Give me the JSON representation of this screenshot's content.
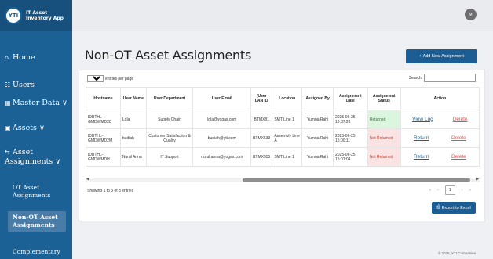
{
  "app": {
    "logo_text": "YTI",
    "name_line1": "IT Asset",
    "name_line2": "Inventory App"
  },
  "user": {
    "initials": "M"
  },
  "sidebar": {
    "items": [
      {
        "icon": "home-icon",
        "glyph": "⌂",
        "label": "Home"
      },
      {
        "icon": "users-icon",
        "glyph": "☷",
        "label": "Users"
      },
      {
        "icon": "database-icon",
        "glyph": "▦",
        "label": "Master Data ∨"
      },
      {
        "icon": "assets-icon",
        "glyph": "▣",
        "label": "Assets ∨"
      },
      {
        "icon": "swap-icon",
        "glyph": "⇆",
        "label": "Asset",
        "label2": "Assignments ∨"
      }
    ],
    "sub_items": [
      {
        "label": "OT Asset",
        "label2": "Assignments"
      },
      {
        "label": "Non-OT Asset",
        "label2": "Assignments"
      },
      {
        "label": "Complementary"
      }
    ]
  },
  "page": {
    "title": "Non-OT Asset Assignments",
    "add_button": "+ Add New Assignment",
    "entries_value": "10",
    "entries_label": "entries per page",
    "search_label": "Search:",
    "search_value": "",
    "showing": "Showing 1 to 3 of 3 entries",
    "pager": {
      "first": "«",
      "prev": "‹",
      "current": "1",
      "next": "›",
      "last": "»"
    },
    "export_button": "Export to Excel",
    "footer": "© 2025, YTI Companies"
  },
  "table": {
    "headers": [
      "Hostname",
      "User Name",
      "User Department",
      "User Email",
      "(User LAN ID",
      "Location",
      "Assigned By",
      "Assignment Date",
      "Assignment Status",
      "Action"
    ],
    "rows": [
      {
        "hostname": "IDBTHL-GMDWMD28",
        "user_name": "Lola",
        "department": "Supply Chain",
        "email": "lola@yogas.com",
        "lan_id": "BTMX81",
        "location": "SMT Line 1",
        "assigned_by": "Yumna Rahi",
        "date": "2025-06-25 13:37:28",
        "status": "Returned",
        "status_type": "returned",
        "action1": "View Log",
        "action2": "Delete"
      },
      {
        "hostname": "IDBTHL-GMDWMD2M",
        "user_name": "budiah",
        "department": "Customer Satisfaction & Quality",
        "email": "budiah@yti.com",
        "lan_id": "BTMX539",
        "location": "Assembly Line A",
        "assigned_by": "Yumna Rahi",
        "date": "2025-06-25 15:00:11",
        "status": "Not Returned",
        "status_type": "not-returned",
        "action1": "Return",
        "action2": "Delete"
      },
      {
        "hostname": "IDBTHL-GMDWMDH",
        "user_name": "Nurul Anna",
        "department": "IT Support",
        "email": "nurul.anna@yogas.com",
        "lan_id": "BTMX555",
        "location": "SMT Line 1",
        "assigned_by": "Yumna Rahi",
        "date": "2025-06-25 15:01:04",
        "status": "Not Returned",
        "status_type": "not-returned",
        "action1": "Return",
        "action2": "Delete"
      }
    ]
  },
  "colors": {
    "sidebar": "#1b6196",
    "primary_button": "#1c5d94",
    "returned_bg": "#dcf5df",
    "not_returned_bg": "#fbe2e3",
    "delete_link": "#d9534f"
  }
}
